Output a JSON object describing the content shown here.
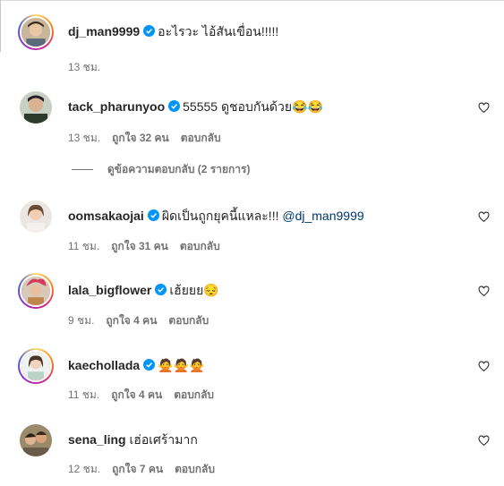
{
  "comments": [
    {
      "username": "dj_man9999",
      "verified": true,
      "text": "อะไรวะ ไอ้สันเขื่อน!!!!!",
      "time": "13 ชม.",
      "likes": "",
      "reply": "",
      "ring": true
    },
    {
      "username": "tack_pharunyoo",
      "verified": true,
      "text": "55555 ดูชอบกันด้วย",
      "emoji": "😂😂",
      "time": "13 ชม.",
      "likes": "ถูกใจ 32 คน",
      "reply": "ตอบกลับ",
      "ring": false
    },
    {
      "username": "oomsakaojai",
      "verified": true,
      "text": "ผิดเป็นถูกยุคนี้แหละ!!! ",
      "mention": "@dj_man9999",
      "time": "11 ชม.",
      "likes": "ถูกใจ 31 คน",
      "reply": "ตอบกลับ",
      "ring": false
    },
    {
      "username": "lala_bigflower",
      "verified": true,
      "text": "เฮ้ยยย",
      "emoji": "😔",
      "time": "9 ชม.",
      "likes": "ถูกใจ 4 คน",
      "reply": "ตอบกลับ",
      "ring": true
    },
    {
      "username": "kaechollada",
      "verified": true,
      "text": "",
      "emoji": "🙅🙅🙅",
      "time": "11 ชม.",
      "likes": "ถูกใจ 4 คน",
      "reply": "ตอบกลับ",
      "ring": true
    },
    {
      "username": "sena_ling",
      "verified": false,
      "text": "เฮ่อเศร้ามาก",
      "time": "12 ชม.",
      "likes": "ถูกใจ 7 คน",
      "reply": "ตอบกลับ",
      "ring": false
    }
  ],
  "view_replies": "ดูข้อความตอบกลับ (2 รายการ)",
  "colors": {
    "verified": "#0095f6",
    "text": "#262626",
    "meta": "#737373",
    "mention": "#00376b"
  },
  "icons": {
    "like": "heart-outline-icon",
    "verified": "verified-badge-icon"
  }
}
